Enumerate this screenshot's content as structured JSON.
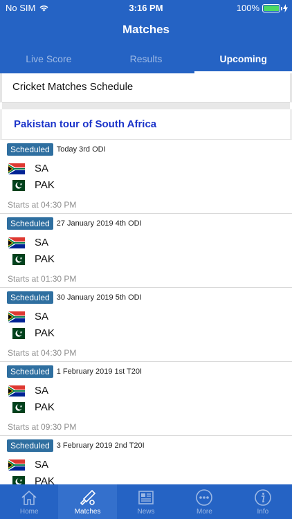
{
  "status": {
    "carrier": "No SIM",
    "time": "3:16 PM",
    "battery": "100%"
  },
  "header": {
    "title": "Matches"
  },
  "tabs": [
    {
      "label": "Live Score"
    },
    {
      "label": "Results"
    },
    {
      "label": "Upcoming"
    }
  ],
  "schedule_title": "Cricket Matches Schedule",
  "tour_title": "Pakistan tour of South Africa",
  "matches": [
    {
      "status": "Scheduled",
      "desc": "Today 3rd ODI",
      "team1": "SA",
      "team2": "PAK",
      "start": "Starts at 04:30 PM"
    },
    {
      "status": "Scheduled",
      "desc": "27 January 2019 4th ODI",
      "team1": "SA",
      "team2": "PAK",
      "start": "Starts at 01:30 PM"
    },
    {
      "status": "Scheduled",
      "desc": "30 January 2019 5th ODI",
      "team1": "SA",
      "team2": "PAK",
      "start": "Starts at 04:30 PM"
    },
    {
      "status": "Scheduled",
      "desc": "1 February 2019 1st T20I",
      "team1": "SA",
      "team2": "PAK",
      "start": "Starts at 09:30 PM"
    },
    {
      "status": "Scheduled",
      "desc": "3 February 2019 2nd T20I",
      "team1": "SA",
      "team2": "PAK",
      "start": ""
    }
  ],
  "nav": [
    {
      "label": "Home",
      "icon": "home-icon"
    },
    {
      "label": "Matches",
      "icon": "cricket-bat-icon"
    },
    {
      "label": "News",
      "icon": "newspaper-icon"
    },
    {
      "label": "More",
      "icon": "more-icon"
    },
    {
      "label": "Info",
      "icon": "info-icon"
    }
  ],
  "colors": {
    "primary": "#2563c4",
    "badge": "#2f6fa0",
    "tour_title": "#1a33c9"
  }
}
